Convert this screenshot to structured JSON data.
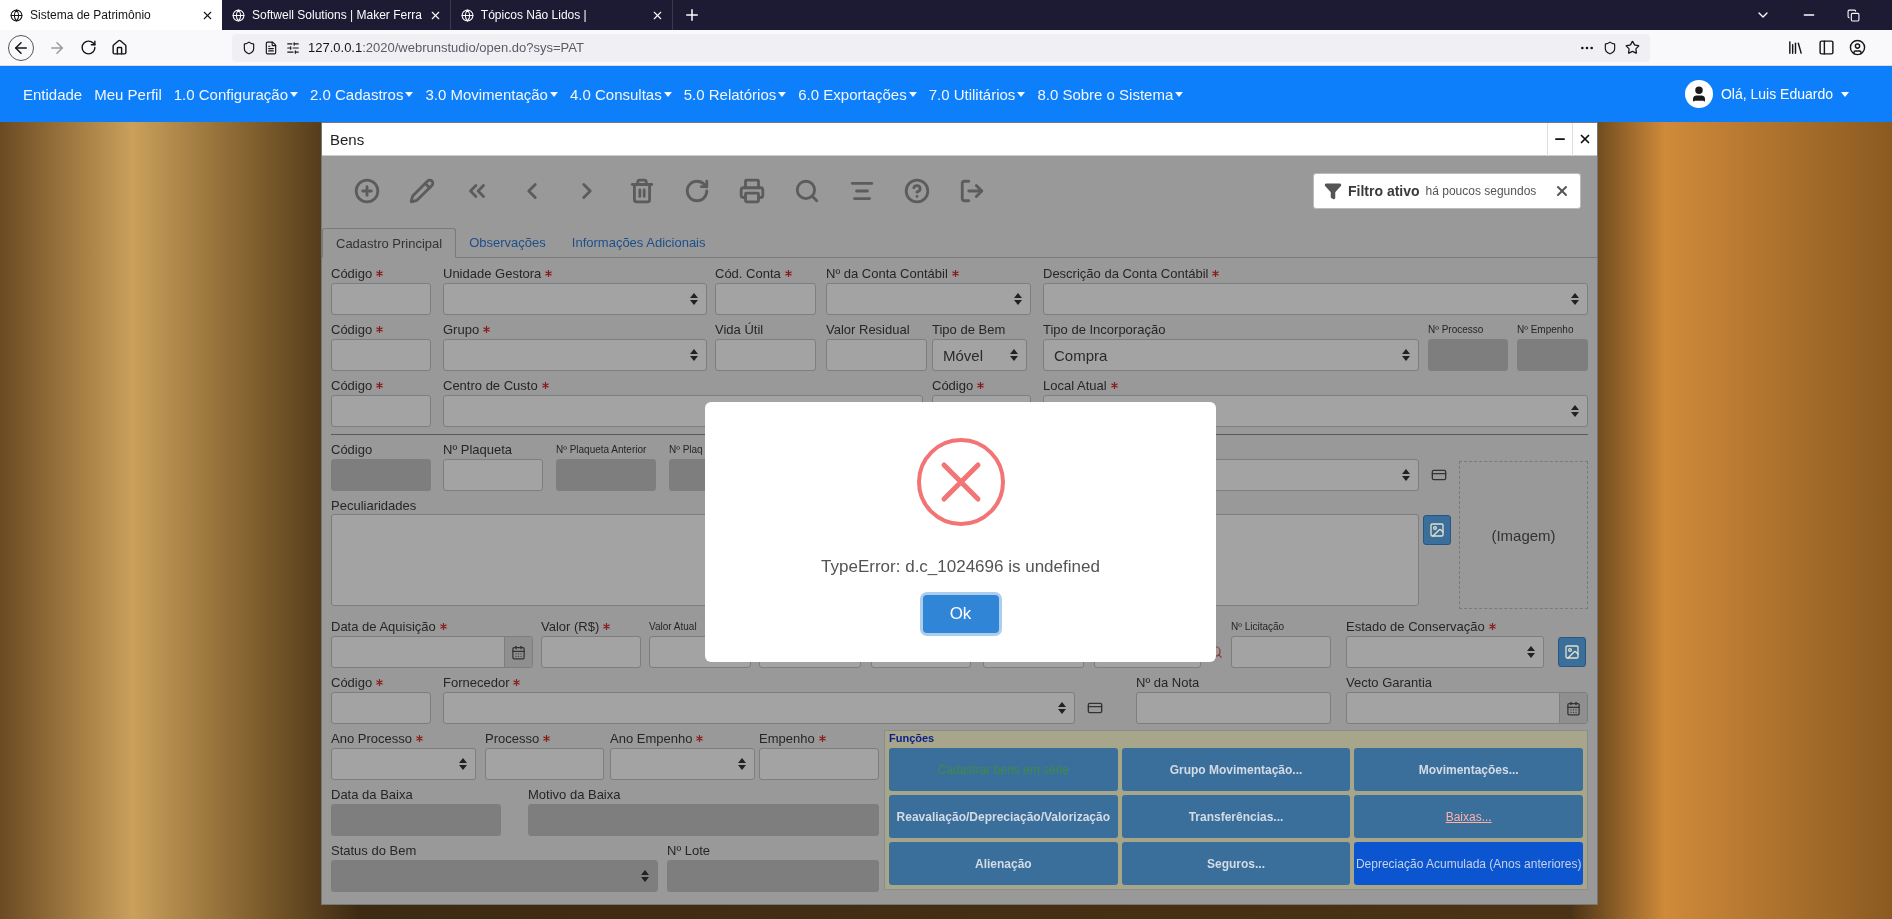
{
  "browser": {
    "tabs": [
      {
        "title": "Sistema de Patrimônio",
        "selected": true
      },
      {
        "title": "Softwell Solutions | Maker Ferra",
        "selected": false
      },
      {
        "title": "Tópicos Não Lidos |",
        "selected": false
      }
    ],
    "url_host": "127.0.0.1",
    "url_path": ":2020/webrunstudio/open.do?sys=PAT"
  },
  "menu": {
    "items": [
      {
        "label": "Entidade",
        "dropdown": false
      },
      {
        "label": "Meu Perfil",
        "dropdown": false
      },
      {
        "label": "1.0 Configuração",
        "dropdown": true
      },
      {
        "label": "2.0 Cadastros",
        "dropdown": true
      },
      {
        "label": "3.0 Movimentação",
        "dropdown": true
      },
      {
        "label": "4.0 Consultas",
        "dropdown": true
      },
      {
        "label": "5.0 Relatórios",
        "dropdown": true
      },
      {
        "label": "6.0 Exportações",
        "dropdown": true
      },
      {
        "label": "7.0 Utilitários",
        "dropdown": true
      },
      {
        "label": "8.0 Sobre o Sistema",
        "dropdown": true
      }
    ],
    "user": "Olá, Luis Eduardo"
  },
  "window": {
    "title": "Bens",
    "filter": {
      "label": "Filtro ativo",
      "time": "há poucos segundos"
    },
    "tabs": [
      {
        "label": "Cadastro Principal",
        "selected": true
      },
      {
        "label": "Observações",
        "selected": false
      },
      {
        "label": "Informações Adicionais",
        "selected": false
      }
    ]
  },
  "form": {
    "top_rows": [
      [
        {
          "label": "Código",
          "kind": "input",
          "required": true,
          "disabled": false
        },
        {
          "label": "Unidade Gestora",
          "kind": "select",
          "required": true,
          "disabled": false
        },
        {
          "label": "Cód. Conta",
          "kind": "input",
          "required": true,
          "disabled": false
        },
        {
          "label": "Nº da Conta Contábil",
          "kind": "select",
          "required": true,
          "disabled": false
        },
        {
          "label": "Descrição da Conta Contábil",
          "kind": "select",
          "required": true,
          "disabled": false
        }
      ],
      [
        {
          "label": "Código",
          "kind": "input",
          "required": true,
          "disabled": false
        },
        {
          "label": "Grupo",
          "kind": "select",
          "required": true,
          "disabled": false
        },
        {
          "label": "Vida Útil",
          "kind": "input",
          "required": false,
          "disabled": false
        },
        {
          "label": "Valor Residual",
          "kind": "input",
          "required": false,
          "disabled": false
        },
        {
          "label": "Tipo de Bem",
          "kind": "select",
          "value": "Móvel",
          "required": false,
          "disabled": false
        },
        {
          "label": "Tipo de Incorporação",
          "kind": "select",
          "value": "Compra",
          "required": false,
          "disabled": false
        },
        {
          "label": "Nº Processo",
          "kind": "input",
          "required": false,
          "disabled": true
        },
        {
          "label": "Nº Empenho",
          "kind": "input",
          "required": false,
          "disabled": true
        }
      ],
      [
        {
          "label": "Código",
          "kind": "input",
          "required": true,
          "disabled": false
        },
        {
          "label": "Centro de Custo",
          "kind": "input",
          "required": true,
          "disabled": false
        },
        {
          "label": "Código",
          "kind": "input",
          "required": true,
          "disabled": false
        },
        {
          "label": "Local Atual",
          "kind": "select",
          "required": true,
          "disabled": false
        }
      ]
    ],
    "media": {
      "fields": [
        {
          "label": "Código",
          "kind": "input",
          "required": false,
          "disabled": true
        },
        {
          "label": "Nº Plaqueta",
          "kind": "input",
          "required": false,
          "disabled": false
        },
        {
          "label": "Nº Plaqueta Anterior",
          "kind": "input",
          "required": false,
          "disabled": true
        },
        {
          "label": "Nº Plaq",
          "kind": "input",
          "required": false,
          "disabled": true
        },
        {
          "kind": "select",
          "disabled": false
        }
      ],
      "notes_label": "Peculiaridades",
      "image": "(Imagem)"
    },
    "mid_rows": [
      [
        {
          "label": "Data de Aquisição",
          "kind": "date",
          "required": true,
          "disabled": false
        },
        {
          "label": "Valor (R$)",
          "kind": "input",
          "required": true,
          "disabled": false
        },
        {
          "label": "Valor Atual",
          "kind": "input",
          "required": false,
          "disabled": false
        },
        {
          "kind": "input",
          "disabled": false
        },
        {
          "kind": "input",
          "disabled": false
        },
        {
          "kind": "input",
          "disabled": false
        },
        {
          "kind": "input",
          "disabled": false
        },
        {
          "label": "Nº Licitação",
          "kind": "input",
          "required": false,
          "disabled": false
        },
        {
          "label": "Estado de Conservação",
          "kind": "select",
          "required": true,
          "disabled": false
        }
      ],
      [
        {
          "label": "Código",
          "kind": "input",
          "required": true,
          "disabled": false
        },
        {
          "label": "Fornecedor",
          "kind": "select",
          "required": true,
          "disabled": false
        },
        {
          "label": "Nº da Nota",
          "kind": "input",
          "required": false,
          "disabled": false
        },
        {
          "label": "Vecto Garantia",
          "kind": "date",
          "required": false,
          "disabled": false
        }
      ]
    ],
    "bottom_rows": [
      [
        {
          "label": "Ano Processo",
          "kind": "select",
          "required": true,
          "disabled": false
        },
        {
          "label": "Processo",
          "kind": "input",
          "required": true,
          "disabled": false
        },
        {
          "label": "Ano Empenho",
          "kind": "select",
          "required": true,
          "disabled": false
        },
        {
          "label": "Empenho",
          "kind": "input",
          "required": true,
          "disabled": false
        }
      ],
      [
        {
          "label": "Data da Baixa",
          "kind": "input",
          "required": false,
          "disabled": true
        },
        {
          "label": "Motivo da Baixa",
          "kind": "input",
          "required": false,
          "disabled": true
        }
      ],
      [
        {
          "label": "Status do Bem",
          "kind": "select",
          "required": false,
          "disabled": true
        },
        {
          "label": "Nº Lote",
          "kind": "input",
          "required": false,
          "disabled": true
        }
      ]
    ],
    "functions": {
      "title": "Funções",
      "buttons": [
        {
          "label": "Cadastrar bens em série",
          "kind": "success"
        },
        {
          "label": "Grupo Movimentação...",
          "kind": "default"
        },
        {
          "label": "Movimentações...",
          "kind": "default"
        },
        {
          "label": "Reavaliação/Depreciação/Valorização",
          "kind": "default"
        },
        {
          "label": "Transferências...",
          "kind": "default"
        },
        {
          "label": "Baixas...",
          "kind": "danger"
        },
        {
          "label": "Alienação",
          "kind": "default"
        },
        {
          "label": "Seguros...",
          "kind": "default"
        },
        {
          "label": "Depreciação Acumulada (Anos anteriores)",
          "kind": "primary"
        }
      ]
    }
  },
  "modal": {
    "message": "TypeError: d.c_1024696 is undefined",
    "button": "Ok"
  }
}
